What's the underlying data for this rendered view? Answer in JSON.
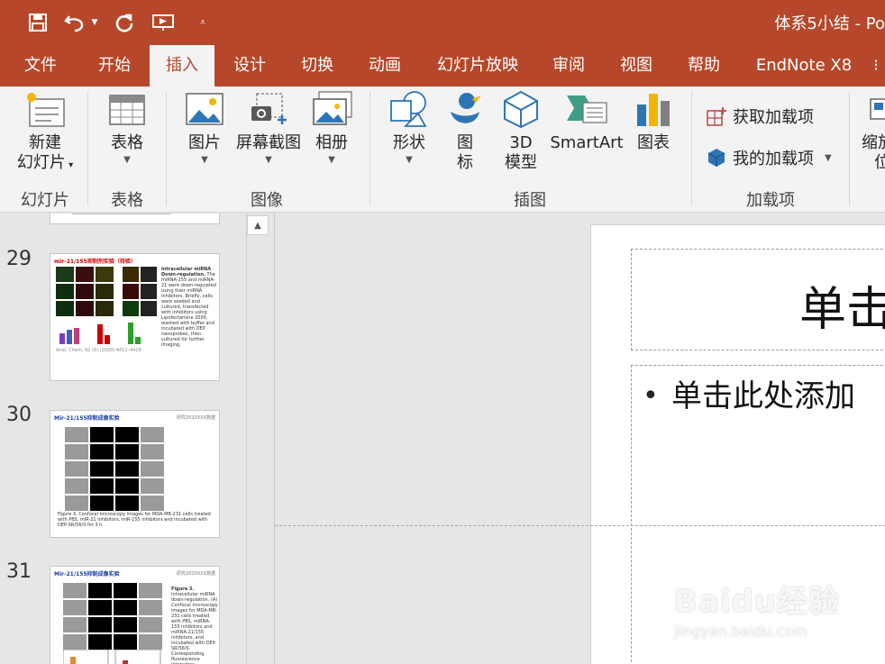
{
  "titlebar": {
    "doc_title": "体系5小结 - Po"
  },
  "tabs": [
    "文件",
    "开始",
    "插入",
    "设计",
    "切换",
    "动画",
    "幻灯片放映",
    "审阅",
    "视图",
    "帮助",
    "EndNote X8"
  ],
  "active_tab": "插入",
  "ribbon": {
    "new_slide_line1": "新建",
    "new_slide_line2": "幻灯片",
    "table": "表格",
    "picture": "图片",
    "screenshot": "屏幕截图",
    "album": "相册",
    "shapes": "形状",
    "icons_line1": "图",
    "icons_line2": "标",
    "model3d_line1": "3D",
    "model3d_line2": "模型",
    "smartart": "SmartArt",
    "chart": "图表",
    "get_addins": "获取加载项",
    "my_addins": "我的加载项",
    "zoom_line1": "缩放",
    "zoom_line2": "位",
    "groups": {
      "slides": "幻灯片",
      "tables": "表格",
      "images": "图像",
      "illustrations": "插图",
      "addins": "加载项"
    }
  },
  "thumbnails": [
    {
      "number": "29",
      "title": "mir-21/155抑制剂实验（待验）",
      "cite": "Anal. Chem. 92 (6) (2020) 4411–4418"
    },
    {
      "number": "30",
      "title": "Mir-21/155抑制成像实验",
      "tag": "研究2020XXX数据",
      "caption": "Figure 3. Confocal microscopy images for MDA-MB-231 cells treated with PBS, miR-21 inhibitors, miR-155 inhibitors and incubated with DEP-SR/56/S for 3 h."
    },
    {
      "number": "31",
      "title": "Mir-21/155抑制成像实验",
      "tag": "研究2020XXX数据"
    }
  ],
  "slide": {
    "title_placeholder": "单击",
    "body_placeholder": "单击此处添加",
    "bullet": "•"
  },
  "watermark": {
    "line1": "Baidu经验",
    "line2": "jingyan.baidu.com"
  },
  "colors": {
    "accent": "#b7472a",
    "ribbon_bg": "#f3f3f3",
    "pane_bg": "#e6e6e6"
  }
}
